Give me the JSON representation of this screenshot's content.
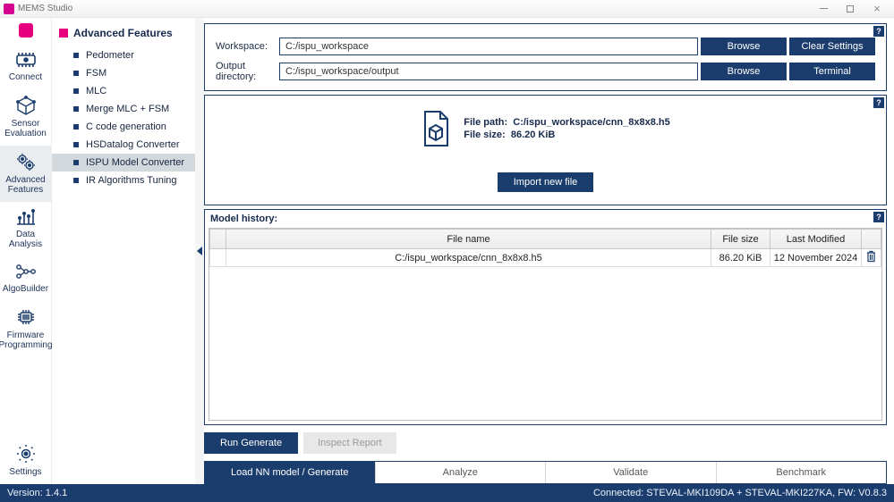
{
  "window": {
    "title": "MEMS Studio"
  },
  "rail": {
    "items": [
      {
        "id": "connect",
        "label": "Connect"
      },
      {
        "id": "sensor-evaluation",
        "label": "Sensor\nEvaluation"
      },
      {
        "id": "advanced-features",
        "label": "Advanced\nFeatures"
      },
      {
        "id": "data-analysis",
        "label": "Data\nAnalysis"
      },
      {
        "id": "algobuilder",
        "label": "AlgoBuilder"
      },
      {
        "id": "firmware-programming",
        "label": "Firmware\nProgramming"
      }
    ],
    "settings_label": "Settings"
  },
  "sidenav": {
    "heading": "Advanced Features",
    "items": [
      "Pedometer",
      "FSM",
      "MLC",
      "Merge MLC + FSM",
      "C code generation",
      "HSDatalog Converter",
      "ISPU Model Converter",
      "IR Algorithms Tuning"
    ],
    "selected_index": 6
  },
  "workspace": {
    "label": "Workspace:",
    "value": "C:/ispu_workspace",
    "browse": "Browse",
    "clear": "Clear Settings"
  },
  "output": {
    "label": "Output directory:",
    "value": "C:/ispu_workspace/output",
    "browse": "Browse",
    "terminal": "Terminal"
  },
  "fileinfo": {
    "path_label": "File path:",
    "path_value": "C:/ispu_workspace/cnn_8x8x8.h5",
    "size_label": "File size:",
    "size_value": "86.20 KiB",
    "import_btn": "Import new file"
  },
  "history": {
    "heading": "Model history:",
    "columns": {
      "name": "File name",
      "size": "File size",
      "modified": "Last Modified"
    },
    "rows": [
      {
        "name": "C:/ispu_workspace/cnn_8x8x8.h5",
        "size": "86.20 KiB",
        "modified": "12 November 2024"
      }
    ]
  },
  "actions": {
    "run": "Run Generate",
    "inspect": "Inspect Report"
  },
  "tabs": {
    "items": [
      "Load NN model / Generate",
      "Analyze",
      "Validate",
      "Benchmark"
    ],
    "active_index": 0
  },
  "status": {
    "version": "Version: 1.4.1",
    "connected": "Connected:  STEVAL-MKI109DA + STEVAL-MKI227KA, FW: V0.8.3"
  },
  "help": "?"
}
